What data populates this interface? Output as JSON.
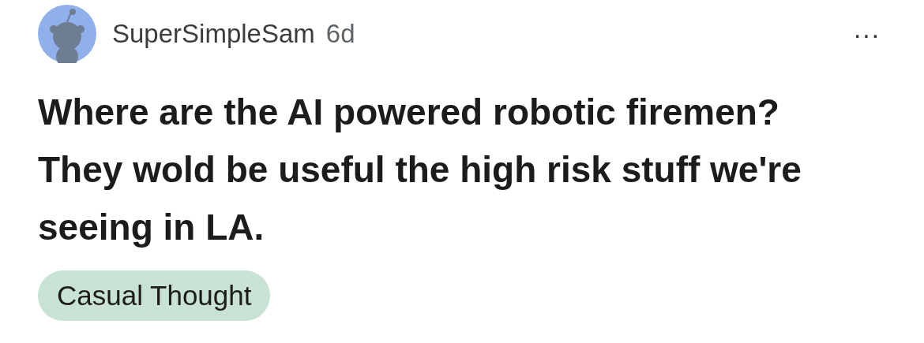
{
  "post": {
    "author": "SuperSimpleSam",
    "age": "6d",
    "menu": "···",
    "title": "Where are the AI powered robotic firemen? They wold be useful the high risk stuff we're seeing in LA.",
    "flair": {
      "label": "Casual Thought",
      "color": "#c8e2d3"
    }
  }
}
